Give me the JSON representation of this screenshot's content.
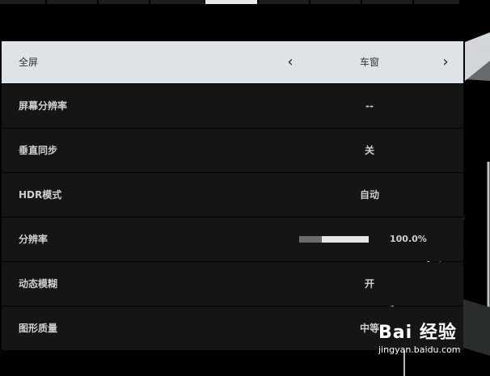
{
  "settings": [
    {
      "label": "全屏",
      "value": "车窗"
    },
    {
      "label": "屏幕分辨率",
      "value": "--"
    },
    {
      "label": "垂直同步",
      "value": "关"
    },
    {
      "label": "HDR模式",
      "value": "自动"
    },
    {
      "label": "分辨率",
      "value": "100.0%",
      "slider_percent": 100
    },
    {
      "label": "动态模糊",
      "value": "开"
    },
    {
      "label": "图形质量",
      "value": "中等"
    }
  ],
  "selector": {
    "prev_icon": "chevron-left-icon",
    "next_icon": "chevron-right-icon"
  },
  "watermark": {
    "logo": "Bai 经验",
    "url": "jingyan.baidu.com"
  }
}
